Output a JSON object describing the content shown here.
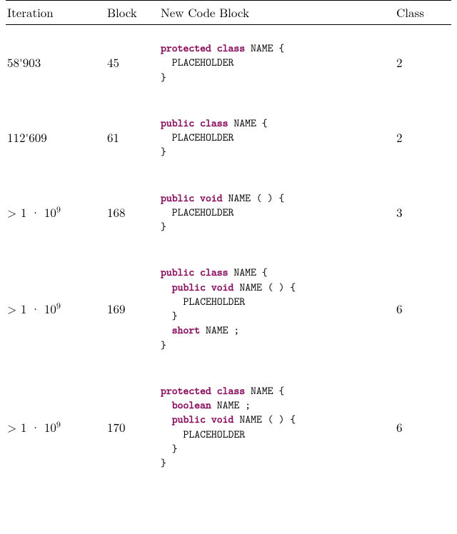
{
  "headers": {
    "iteration": "Iteration",
    "block": "Block",
    "code": "New Code Block",
    "class": "Class"
  },
  "gt": "> 1 · 10",
  "exp9": "9",
  "rows": [
    {
      "iter_plain": "58'903",
      "iter_sci": false,
      "block": "45",
      "class": "2",
      "code": [
        {
          "kind": "kw",
          "t": "protected"
        },
        {
          "kind": "sp"
        },
        {
          "kind": "kw",
          "t": "class"
        },
        {
          "kind": "tx",
          "t": " NAME {"
        },
        {
          "kind": "nl"
        },
        {
          "kind": "tx",
          "t": "  PLACEHOLDER"
        },
        {
          "kind": "nl"
        },
        {
          "kind": "tx",
          "t": "}"
        }
      ]
    },
    {
      "iter_plain": "112'609",
      "iter_sci": false,
      "block": "61",
      "class": "2",
      "code": [
        {
          "kind": "kw",
          "t": "public"
        },
        {
          "kind": "sp"
        },
        {
          "kind": "kw",
          "t": "class"
        },
        {
          "kind": "tx",
          "t": " NAME {"
        },
        {
          "kind": "nl"
        },
        {
          "kind": "tx",
          "t": "  PLACEHOLDER"
        },
        {
          "kind": "nl"
        },
        {
          "kind": "tx",
          "t": "}"
        }
      ]
    },
    {
      "iter_sci": true,
      "block": "168",
      "class": "3",
      "code": [
        {
          "kind": "kw",
          "t": "public"
        },
        {
          "kind": "sp"
        },
        {
          "kind": "kw",
          "t": "void"
        },
        {
          "kind": "tx",
          "t": " NAME ( ) {"
        },
        {
          "kind": "nl"
        },
        {
          "kind": "tx",
          "t": "  PLACEHOLDER"
        },
        {
          "kind": "nl"
        },
        {
          "kind": "tx",
          "t": "}"
        }
      ]
    },
    {
      "iter_sci": true,
      "block": "169",
      "class": "6",
      "code": [
        {
          "kind": "kw",
          "t": "public"
        },
        {
          "kind": "sp"
        },
        {
          "kind": "kw",
          "t": "class"
        },
        {
          "kind": "tx",
          "t": " NAME {"
        },
        {
          "kind": "nl"
        },
        {
          "kind": "tx",
          "t": "  "
        },
        {
          "kind": "kw",
          "t": "public"
        },
        {
          "kind": "sp"
        },
        {
          "kind": "kw",
          "t": "void"
        },
        {
          "kind": "tx",
          "t": " NAME ( ) {"
        },
        {
          "kind": "nl"
        },
        {
          "kind": "tx",
          "t": "    PLACEHOLDER"
        },
        {
          "kind": "nl"
        },
        {
          "kind": "tx",
          "t": "  }"
        },
        {
          "kind": "nl"
        },
        {
          "kind": "tx",
          "t": "  "
        },
        {
          "kind": "kw",
          "t": "short"
        },
        {
          "kind": "tx",
          "t": " NAME ;"
        },
        {
          "kind": "nl"
        },
        {
          "kind": "tx",
          "t": "}"
        }
      ]
    },
    {
      "iter_sci": true,
      "block": "170",
      "class": "6",
      "code": [
        {
          "kind": "kw",
          "t": "protected"
        },
        {
          "kind": "sp"
        },
        {
          "kind": "kw",
          "t": "class"
        },
        {
          "kind": "tx",
          "t": " NAME {"
        },
        {
          "kind": "nl"
        },
        {
          "kind": "tx",
          "t": "  "
        },
        {
          "kind": "kw",
          "t": "boolean"
        },
        {
          "kind": "tx",
          "t": " NAME ;"
        },
        {
          "kind": "nl"
        },
        {
          "kind": "tx",
          "t": "  "
        },
        {
          "kind": "kw",
          "t": "public"
        },
        {
          "kind": "sp"
        },
        {
          "kind": "kw",
          "t": "void"
        },
        {
          "kind": "tx",
          "t": " NAME ( ) {"
        },
        {
          "kind": "nl"
        },
        {
          "kind": "tx",
          "t": "    PLACEHOLDER"
        },
        {
          "kind": "nl"
        },
        {
          "kind": "tx",
          "t": "  }"
        },
        {
          "kind": "nl"
        },
        {
          "kind": "tx",
          "t": "}"
        }
      ]
    }
  ]
}
